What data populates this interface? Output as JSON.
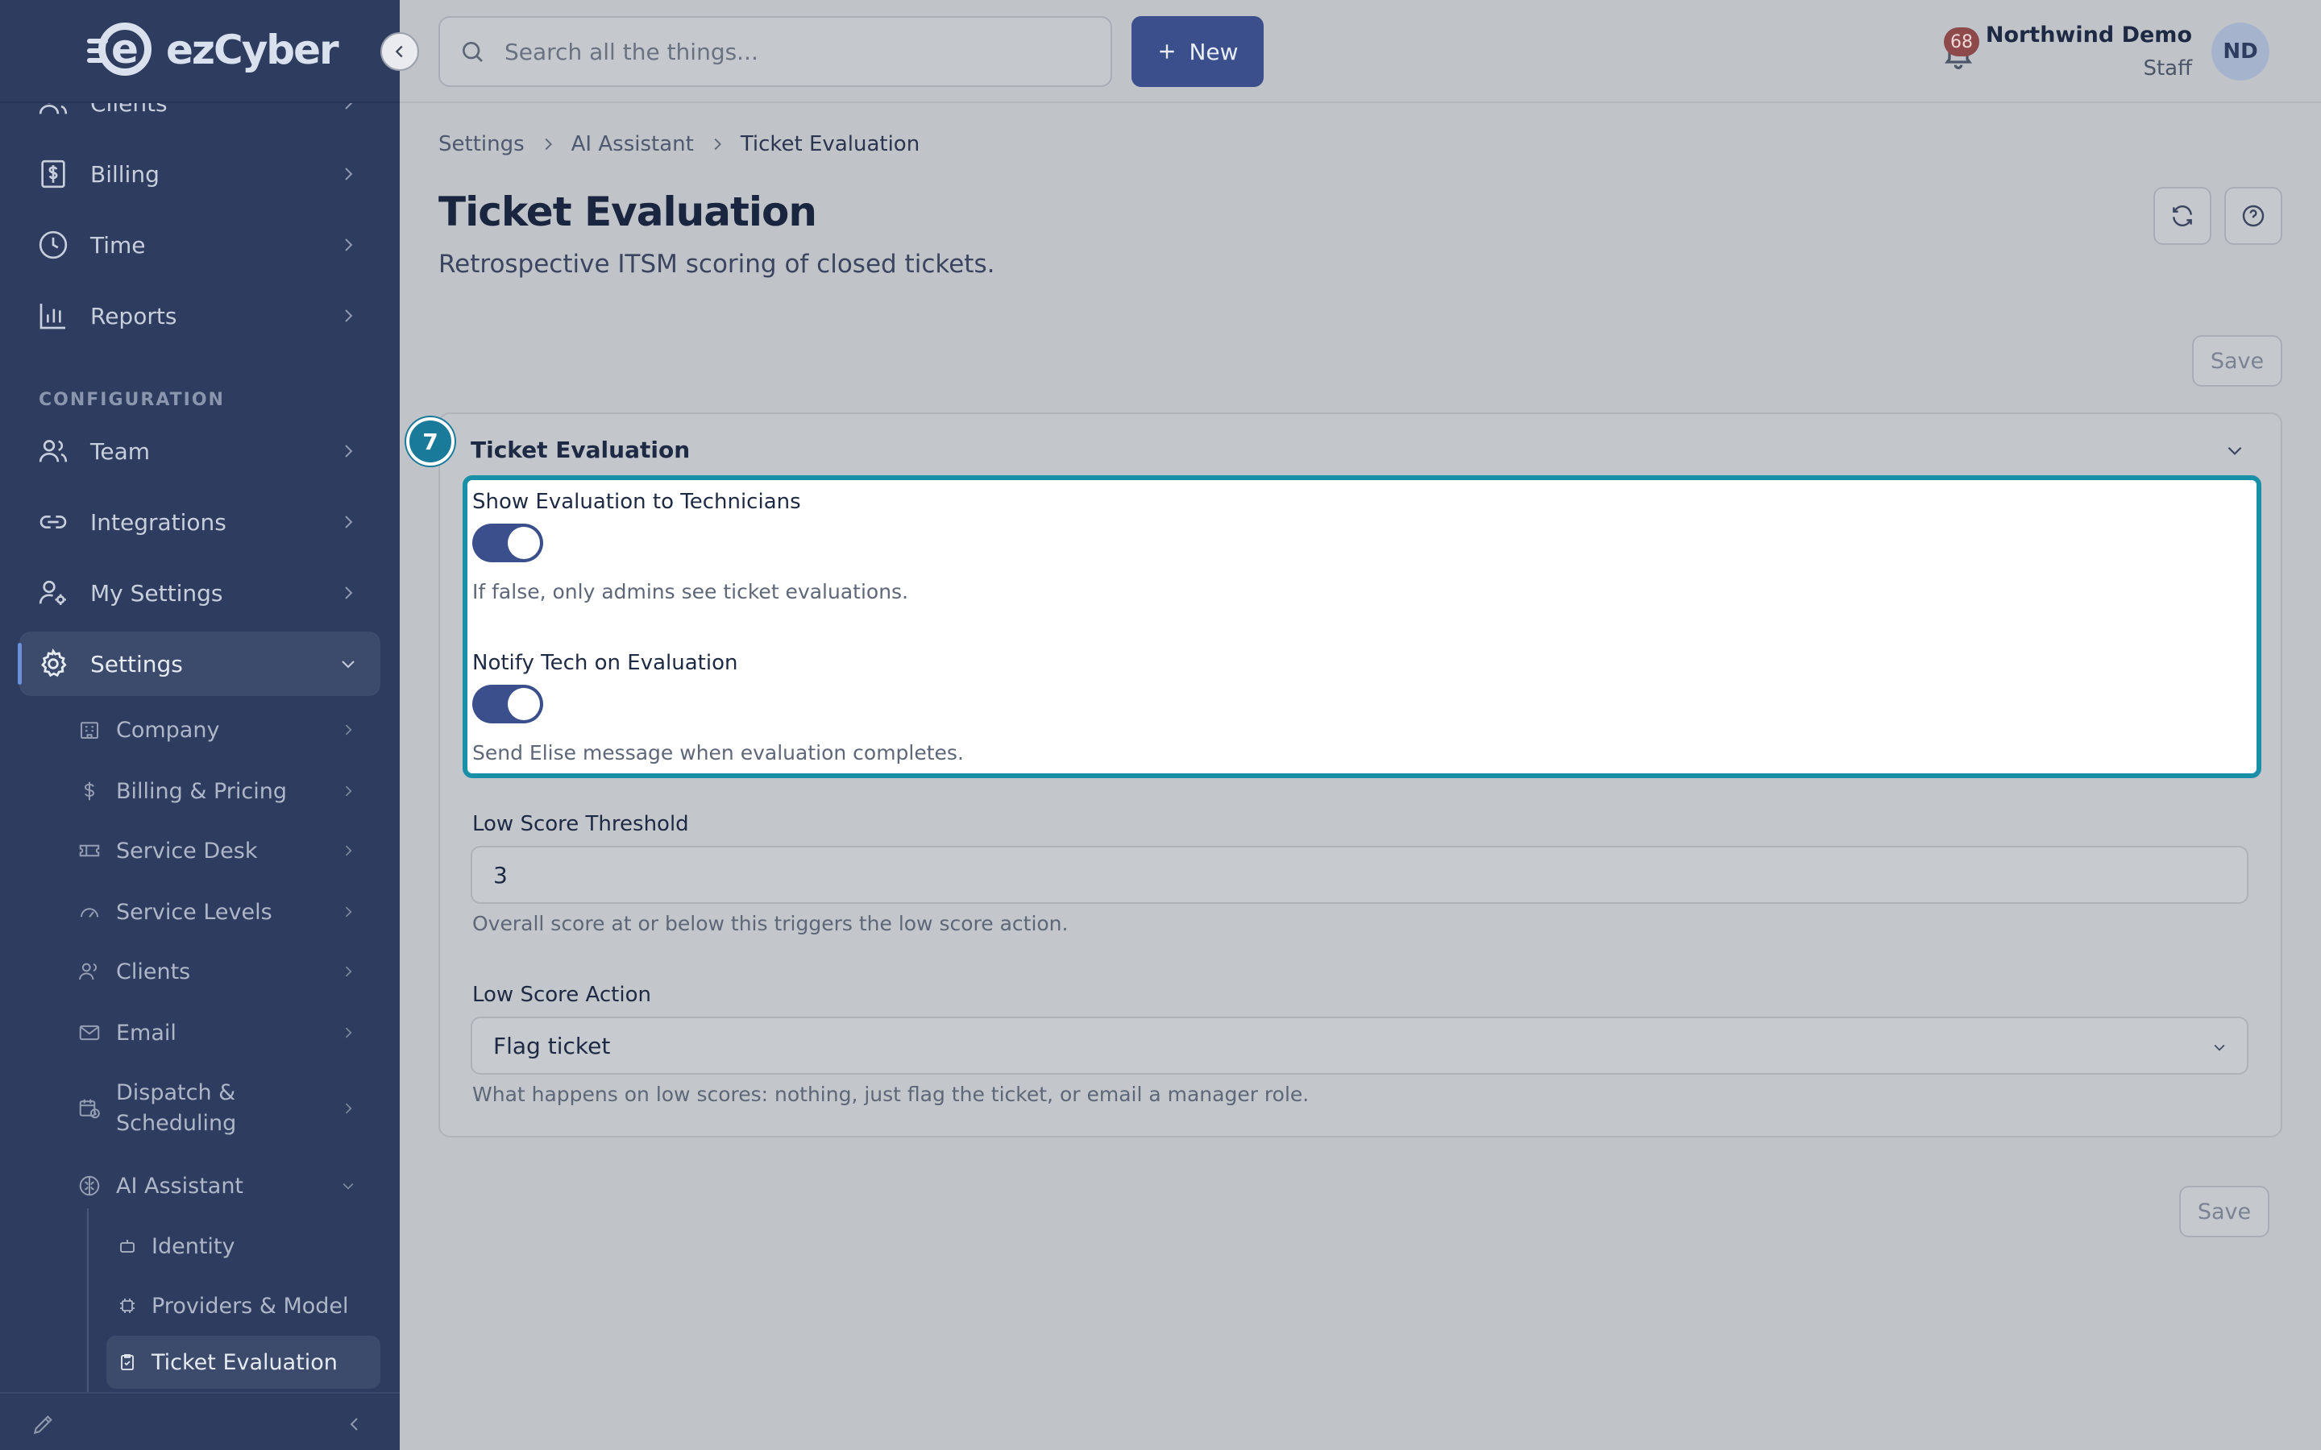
{
  "brand": {
    "logo_text": "ezCyber"
  },
  "sidebar": {
    "items": [
      {
        "label": "Clients",
        "icon": "users-icon"
      },
      {
        "label": "Billing",
        "icon": "billing-icon"
      },
      {
        "label": "Time",
        "icon": "clock-icon"
      },
      {
        "label": "Reports",
        "icon": "bar-chart-icon"
      }
    ],
    "section_label": "CONFIGURATION",
    "config_items": [
      {
        "label": "Team",
        "icon": "team-icon"
      },
      {
        "label": "Integrations",
        "icon": "link-icon"
      },
      {
        "label": "My Settings",
        "icon": "user-gear-icon"
      },
      {
        "label": "Settings",
        "icon": "gear-icon"
      }
    ],
    "settings_children": [
      {
        "label": "Company"
      },
      {
        "label": "Billing & Pricing"
      },
      {
        "label": "Service Desk"
      },
      {
        "label": "Service Levels"
      },
      {
        "label": "Clients"
      },
      {
        "label": "Email"
      },
      {
        "label": "Dispatch & Scheduling"
      },
      {
        "label": "AI Assistant"
      }
    ],
    "ai_children": [
      {
        "label": "Identity"
      },
      {
        "label": "Providers & Model"
      },
      {
        "label": "Ticket Evaluation"
      }
    ]
  },
  "topbar": {
    "search_placeholder": "Search all the things...",
    "new_label": "New",
    "notification_count": "68",
    "user_name": "Northwind Demo",
    "user_role": "Staff",
    "avatar_initials": "ND"
  },
  "breadcrumb": [
    "Settings",
    "AI Assistant",
    "Ticket Evaluation"
  ],
  "page": {
    "title": "Ticket Evaluation",
    "subtitle": "Retrospective ITSM scoring of closed tickets.",
    "save_label": "Save"
  },
  "card": {
    "step": "7",
    "title": "Ticket Evaluation",
    "fields": {
      "show_eval": {
        "label": "Show Evaluation to Technicians",
        "enabled": true,
        "help": "If false, only admins see ticket evaluations."
      },
      "notify_tech": {
        "label": "Notify Tech on Evaluation",
        "enabled": true,
        "help": "Send Elise message when evaluation completes."
      },
      "low_score_threshold": {
        "label": "Low Score Threshold",
        "value": "3",
        "help": "Overall score at or below this triggers the low score action."
      },
      "low_score_action": {
        "label": "Low Score Action",
        "value": "Flag ticket",
        "help": "What happens on low scores: nothing, just flag the ticket, or email a manager role."
      }
    }
  },
  "colors": {
    "sidebar_bg": "#2e3c5f",
    "accent": "#3a4f8c",
    "highlight_border": "#1a8fa8",
    "badge": "#8e4a4a"
  }
}
